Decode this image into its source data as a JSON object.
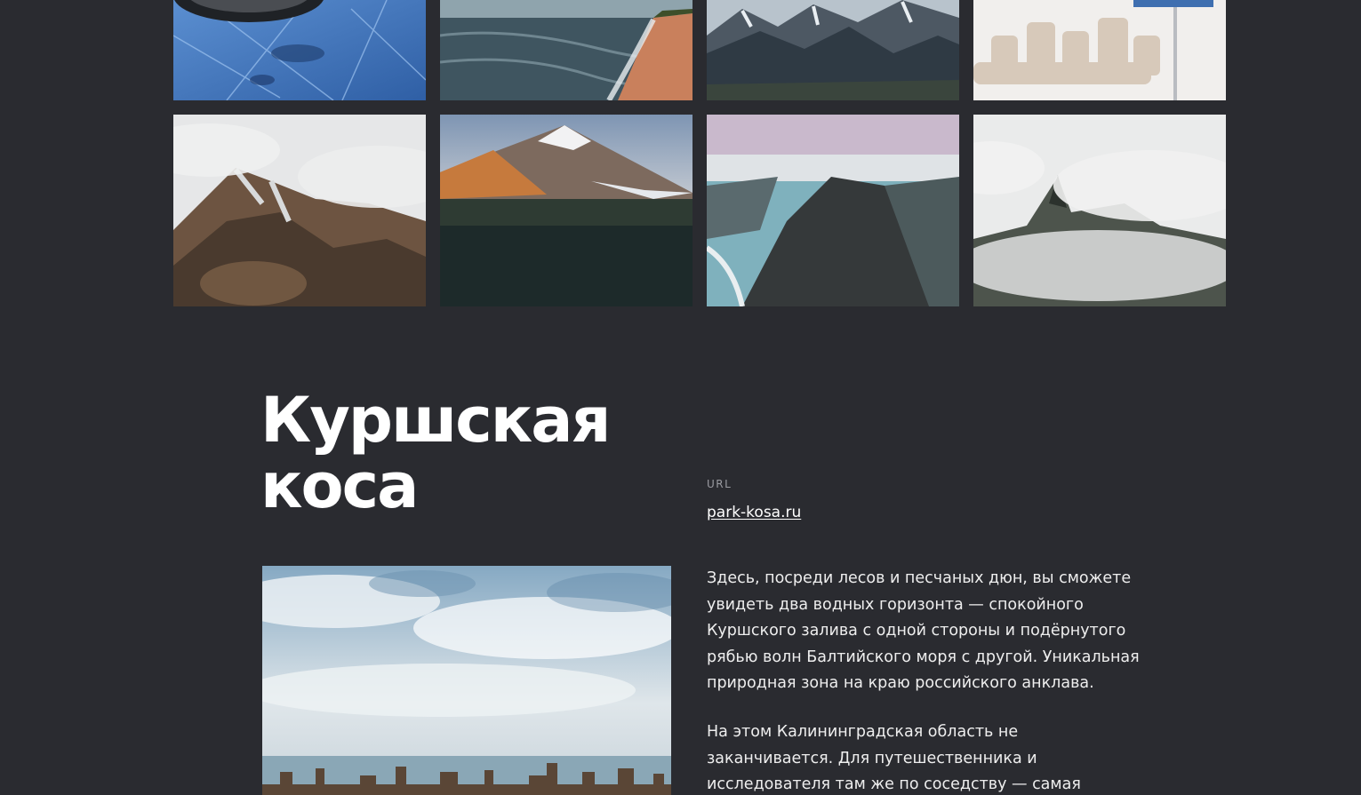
{
  "section": {
    "title": "Куршская коса",
    "url_label": "URL",
    "url_text": "park-kosa.ru",
    "paragraphs": [
      "Здесь, посреди лесов и песчаных дюн, вы сможете увидеть два водных горизонта — спокойного Куршского залива с одной стороны и подёрнутого рябью волн Балтийского моря с другой. Уникальная природная зона на краю российского анклава.",
      "На этом Калининградская область не заканчивается. Для путешественника и исследователя там же по соседству — самая западная точка России,"
    ]
  },
  "colors": {
    "background": "#2a2b30",
    "text": "#ffffff",
    "muted": "#9a9ba1"
  },
  "gallery": [
    {
      "name": "frozen-lake-tire-photo"
    },
    {
      "name": "sea-beach-photo"
    },
    {
      "name": "snowy-mountains-photo"
    },
    {
      "name": "tetrapods-breakwater-photo"
    },
    {
      "name": "misty-volcano-slope-photo"
    },
    {
      "name": "snow-capped-volcano-photo"
    },
    {
      "name": "cliff-ridge-coast-photo"
    },
    {
      "name": "peaks-in-clouds-photo"
    }
  ],
  "feature_image": {
    "name": "sea-stumps-sky-photo"
  }
}
